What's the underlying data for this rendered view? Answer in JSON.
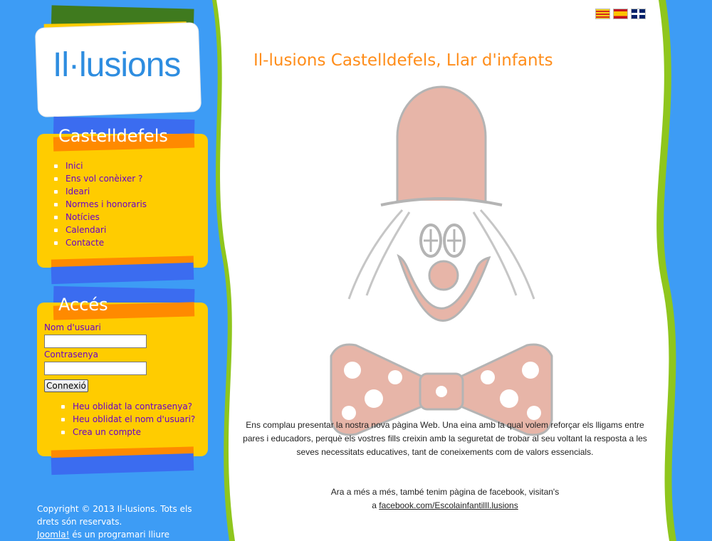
{
  "brand": {
    "logo_text": "Il·lusions"
  },
  "colors": {
    "background_blue": "#3d9cf5",
    "panel_yellow": "#ffcc00",
    "accent_orange": "#ff8d1a",
    "link_purple": "#6a00c8",
    "wave_green": "#8fc61d"
  },
  "languages": [
    "catalan-flag-icon",
    "spanish-flag-icon",
    "english-flag-icon"
  ],
  "nav": {
    "title": "Castelldefels",
    "items": [
      {
        "label": "Inici"
      },
      {
        "label": "Ens vol conèixer ?"
      },
      {
        "label": "Ideari"
      },
      {
        "label": "Normes i honoraris"
      },
      {
        "label": "Notícies"
      },
      {
        "label": "Calendari"
      },
      {
        "label": "Contacte"
      }
    ]
  },
  "login": {
    "title": "Accés",
    "username_label": "Nom d'usuari",
    "username_value": "",
    "password_label": "Contrasenya",
    "password_value": "",
    "submit_label": "Connexió",
    "links": [
      {
        "label": "Heu oblidat la contrasenya?"
      },
      {
        "label": "Heu oblidat el nom d'usuari?"
      },
      {
        "label": "Crea un compte"
      }
    ]
  },
  "footer": {
    "copyright": "Copyright © 2013 Il-lusions.  Tots els drets són reservats.",
    "joomla_link": "Joomla!",
    "joomla_suffix": " és un programari lliure"
  },
  "main": {
    "title": "Il-lusions Castelldefels, Llar d'infants",
    "intro": "Ens complau  presentar la nostra nova pàgina Web. Una eina amb la qual volem reforçar els lligams entre pares i educadors, perquè els vostres fills creixin amb la seguretat de trobar al seu voltant la resposta a les seves necessitats educatives, tant de coneixements com de valors essencials.",
    "facebook_line": "Ara a més a més, també tenim pàgina de facebook, visitan's",
    "facebook_prefix": "a ",
    "facebook_link": "facebook.com/EscolainfantilIl.lusions"
  }
}
